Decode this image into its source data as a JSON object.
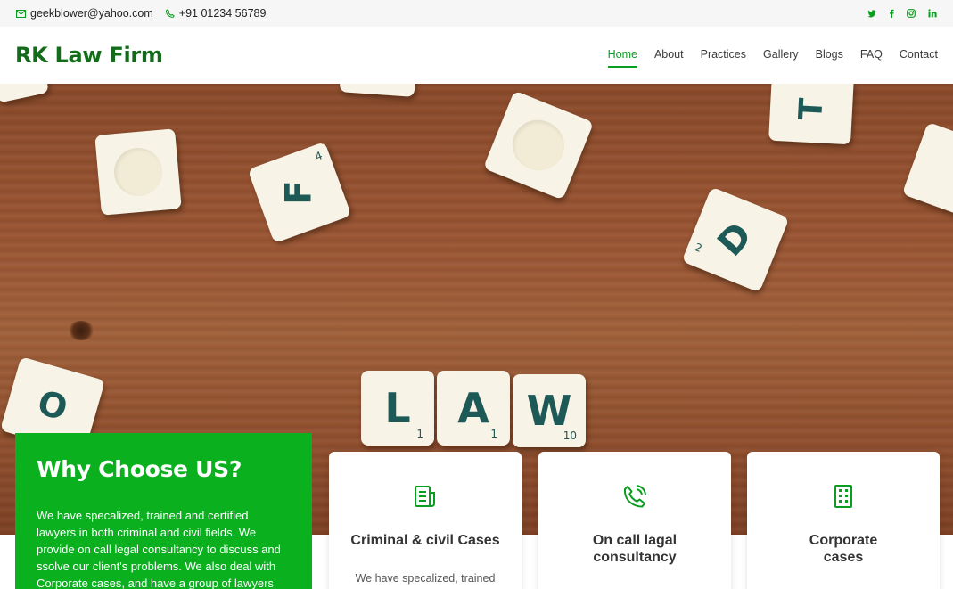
{
  "topbar": {
    "email": "geekblower@yahoo.com",
    "phone": "+91 01234 56789",
    "social": [
      "twitter-icon",
      "facebook-icon",
      "instagram-icon",
      "linkedin-icon"
    ]
  },
  "header": {
    "logo": "RK Law Firm",
    "nav": [
      "Home",
      "About",
      "Practices",
      "Gallery",
      "Blogs",
      "FAQ",
      "Contact"
    ],
    "active_nav": "Home"
  },
  "hero": {
    "tiles": [
      {
        "letter": "F",
        "num": "4"
      },
      {
        "letter": "T",
        "num": ""
      },
      {
        "letter": "D",
        "num": "2"
      },
      {
        "letter": "O",
        "num": ""
      },
      {
        "letter": "L",
        "num": "1"
      },
      {
        "letter": "A",
        "num": "1"
      },
      {
        "letter": "W",
        "num": "10"
      }
    ]
  },
  "why": {
    "title": "Why Choose US?",
    "text": "We have specalized, trained and certified lawyers in both criminal and civil fields. We provide on call legal consultancy to discuss and ssolve our client's problems. We also deal with Corporate cases, and have a group of lawyers"
  },
  "cards": [
    {
      "title": "Criminal & civil Cases",
      "text": "We have specalized, trained",
      "icon": "document-icon"
    },
    {
      "title_line1": "On call lagal",
      "title_line2": "consultancy",
      "icon": "phone-call-icon"
    },
    {
      "title_line1": "Corporate",
      "title_line2": "cases",
      "icon": "building-icon"
    }
  ],
  "colors": {
    "accent": "#0b9d1f",
    "why_bg": "#0bb01f",
    "logo": "#126c1a"
  }
}
